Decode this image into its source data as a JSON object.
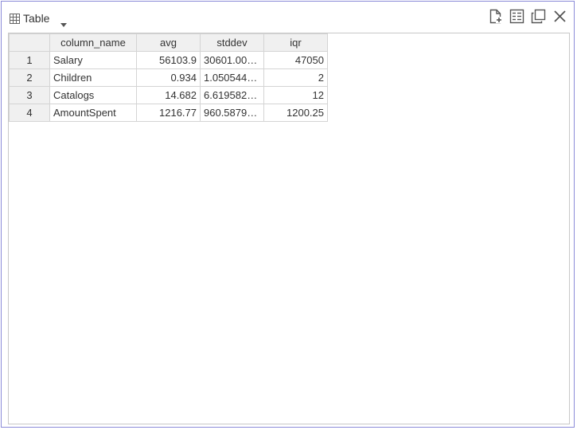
{
  "toolbar": {
    "view_label": "Table",
    "icons": [
      "new-file-icon",
      "details-icon",
      "popout-icon",
      "close-icon"
    ]
  },
  "table": {
    "columns": [
      "",
      "column_name",
      "avg",
      "stddev",
      "iqr"
    ],
    "rows": [
      {
        "index": "1",
        "column_name": "Salary",
        "avg": "56103.9",
        "stddev": "30601.00…",
        "iqr": "47050"
      },
      {
        "index": "2",
        "column_name": "Children",
        "avg": "0.934",
        "stddev": "1.050544…",
        "iqr": "2"
      },
      {
        "index": "3",
        "column_name": "Catalogs",
        "avg": "14.682",
        "stddev": "6.619582…",
        "iqr": "12"
      },
      {
        "index": "4",
        "column_name": "AmountSpent",
        "avg": "1216.77",
        "stddev": "960.5879…",
        "iqr": "1200.25"
      }
    ]
  },
  "colors": {
    "frame_border": "#8a8ad8",
    "header_bg": "#f0f0f0",
    "grid_line": "#d4d4d4",
    "text": "#333333"
  }
}
